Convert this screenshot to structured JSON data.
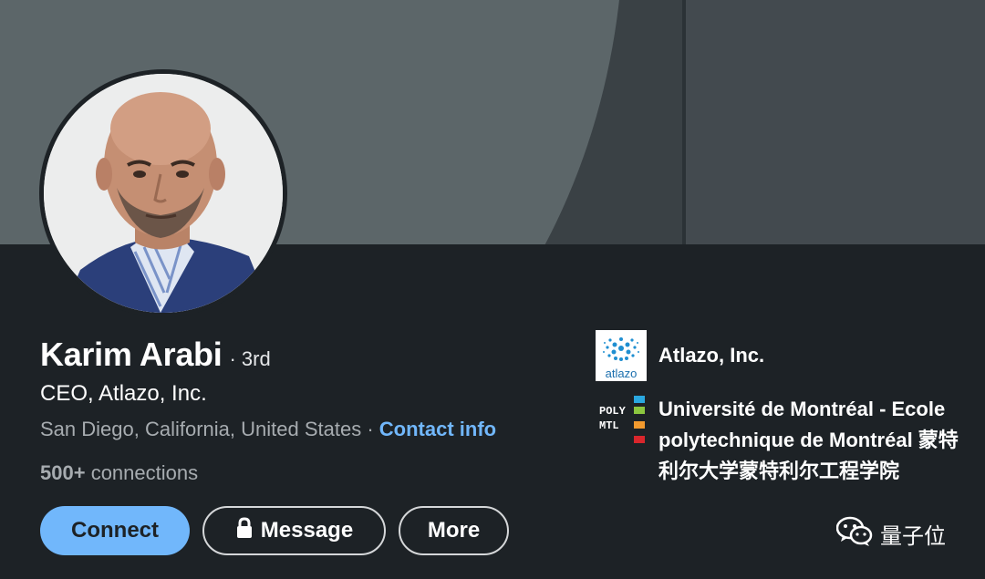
{
  "profile": {
    "name": "Karim Arabi",
    "degree": "· 3rd",
    "headline": "CEO, Atlazo, Inc.",
    "location": "San Diego, California, United States",
    "location_separator": "·",
    "contact_info": "Contact info",
    "connections_count": "500+",
    "connections_label": "connections"
  },
  "actions": {
    "connect": "Connect",
    "message": "Message",
    "more": "More"
  },
  "organizations": [
    {
      "name": "Atlazo, Inc.",
      "logo_text": "atlazo"
    },
    {
      "name": "Université de Montréal - Ecole polytechnique de Montréal 蒙特利尔大学蒙特利尔工程学院",
      "logo_text_1": "POLY",
      "logo_text_2": "MTL"
    }
  ],
  "watermark": {
    "text": "量子位",
    "icon": "wechat-icon"
  },
  "colors": {
    "background": "#1d2226",
    "accent": "#71b7fb",
    "muted_text": "#a7acb0",
    "banner_left": "#3a4145",
    "banner_circle": "#5c6669",
    "banner_right": "#434a4f"
  }
}
